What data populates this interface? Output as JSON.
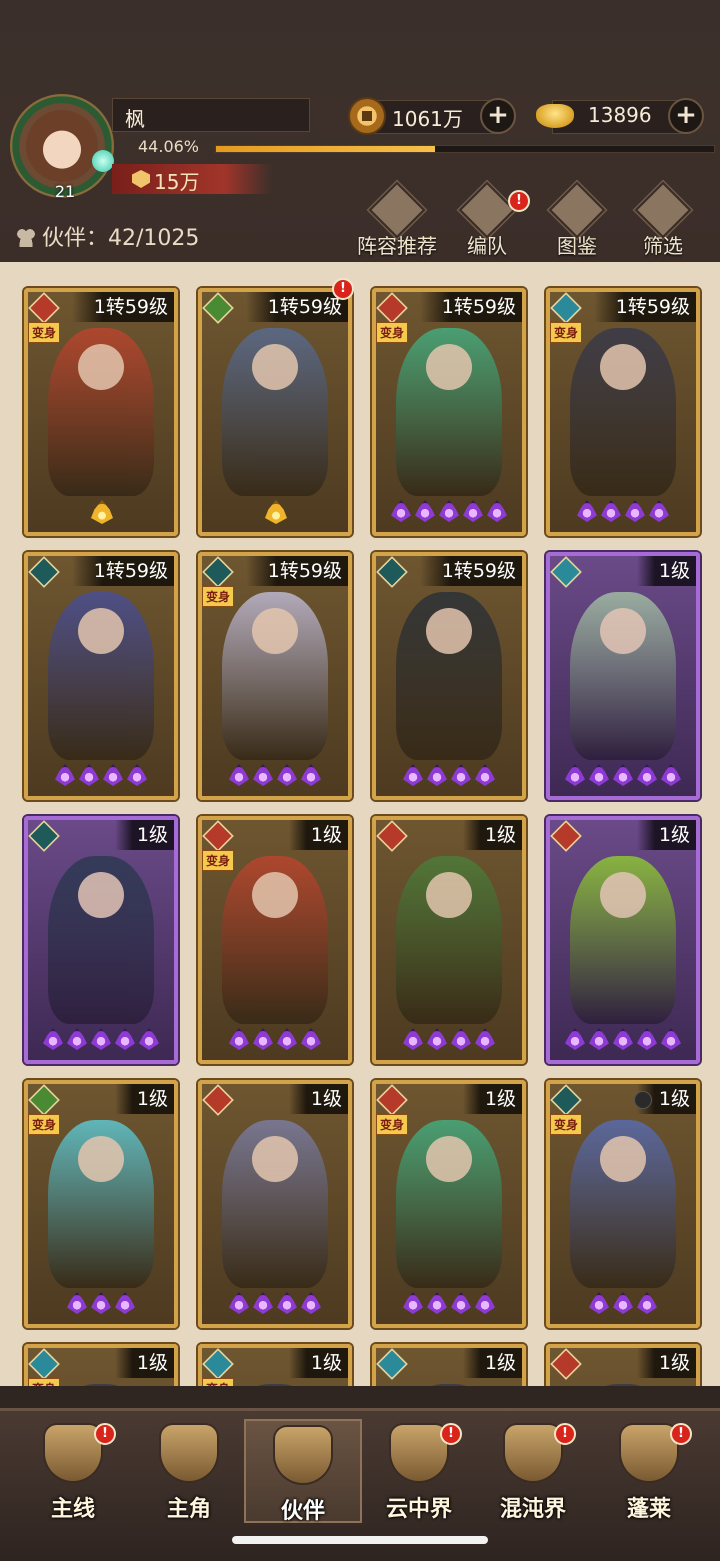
{
  "player": {
    "name": "枫",
    "level": "21",
    "exp_percent": "44.06%",
    "exp_fraction": 0.4406,
    "power": "15万"
  },
  "resources": {
    "coins": "1061万",
    "ingots": "13896",
    "plus_label": "+"
  },
  "partners": {
    "label": "伙伴：",
    "count": "42/1025"
  },
  "toolbar": [
    {
      "label": "阵容推荐",
      "icon": "lineup-recommend-icon",
      "reddot": false
    },
    {
      "label": "编队",
      "icon": "formation-flag-icon",
      "reddot": true
    },
    {
      "label": "图鉴",
      "icon": "codex-scroll-icon",
      "reddot": false
    },
    {
      "label": "筛选",
      "icon": "filter-icon",
      "reddot": false
    }
  ],
  "badge_text": "!",
  "bianshen_label": "变身",
  "cards": [
    {
      "level": "1转59级",
      "frame": "gold",
      "element": "fire",
      "bianshen": true,
      "stars": 0,
      "flame": true,
      "reddot": false,
      "art": "#b5462f"
    },
    {
      "level": "1转59级",
      "frame": "gold",
      "element": "wood",
      "bianshen": false,
      "stars": 0,
      "flame": true,
      "reddot": true,
      "art": "#5a6a8a"
    },
    {
      "level": "1转59级",
      "frame": "gold",
      "element": "fire",
      "bianshen": true,
      "stars": 5,
      "flame": false,
      "reddot": false,
      "art": "#47a77a"
    },
    {
      "level": "1转59级",
      "frame": "gold",
      "element": "water",
      "bianshen": true,
      "stars": 4,
      "flame": false,
      "reddot": false,
      "art": "#3b3b4a"
    },
    {
      "level": "1转59级",
      "frame": "gold",
      "element": "dark",
      "bianshen": false,
      "stars": 4,
      "flame": false,
      "reddot": false,
      "art": "#4b4f8f"
    },
    {
      "level": "1转59级",
      "frame": "gold",
      "element": "dark",
      "bianshen": true,
      "stars": 4,
      "flame": false,
      "reddot": false,
      "art": "#b9b3c9"
    },
    {
      "level": "1转59级",
      "frame": "gold",
      "element": "dark",
      "bianshen": false,
      "stars": 4,
      "flame": false,
      "reddot": false,
      "art": "#2f3338"
    },
    {
      "level": "1级",
      "frame": "purple",
      "element": "water",
      "bianshen": false,
      "stars": 5,
      "flame": false,
      "reddot": false,
      "art": "#9fb7a2"
    },
    {
      "level": "1级",
      "frame": "purple",
      "element": "dark",
      "bianshen": false,
      "stars": 5,
      "flame": false,
      "reddot": false,
      "art": "#2f3a55"
    },
    {
      "level": "1级",
      "frame": "gold",
      "element": "fire",
      "bianshen": true,
      "stars": 4,
      "flame": false,
      "reddot": false,
      "art": "#b5462f"
    },
    {
      "level": "1级",
      "frame": "gold",
      "element": "fire",
      "bianshen": false,
      "stars": 4,
      "flame": false,
      "reddot": false,
      "art": "#4f7a3a"
    },
    {
      "level": "1级",
      "frame": "purple",
      "element": "fire",
      "bianshen": false,
      "stars": 5,
      "flame": false,
      "reddot": false,
      "art": "#8cbf3a"
    },
    {
      "level": "1级",
      "frame": "gold",
      "element": "wood",
      "bianshen": true,
      "stars": 3,
      "flame": false,
      "reddot": false,
      "art": "#5fc0c8"
    },
    {
      "level": "1级",
      "frame": "gold",
      "element": "fire",
      "bianshen": false,
      "stars": 4,
      "flame": false,
      "reddot": false,
      "art": "#7a7a9a"
    },
    {
      "level": "1级",
      "frame": "gold",
      "element": "fire",
      "bianshen": true,
      "stars": 4,
      "flame": false,
      "reddot": false,
      "art": "#47a77a"
    },
    {
      "level": "1级",
      "frame": "gold",
      "element": "dark",
      "bianshen": true,
      "stars": 3,
      "flame": false,
      "reddot": false,
      "art": "#5a6aa8",
      "dim_orb": true
    },
    {
      "level": "1级",
      "frame": "gold",
      "element": "water",
      "bianshen": true,
      "stars": 0,
      "flame": false,
      "reddot": false,
      "art": "#3a3a4a"
    },
    {
      "level": "1级",
      "frame": "gold",
      "element": "water",
      "bianshen": true,
      "stars": 0,
      "flame": false,
      "reddot": false,
      "art": "#3a3a4a"
    },
    {
      "level": "1级",
      "frame": "gold",
      "element": "water",
      "bianshen": false,
      "stars": 0,
      "flame": false,
      "reddot": false,
      "art": "#3a3a4a"
    },
    {
      "level": "1级",
      "frame": "gold",
      "element": "fire",
      "bianshen": false,
      "stars": 0,
      "flame": false,
      "reddot": false,
      "art": "#3a3a4a"
    }
  ],
  "nav": [
    {
      "label": "主线",
      "icon": "main-quest-swords-icon",
      "reddot": true,
      "active": false
    },
    {
      "label": "主角",
      "icon": "hero-portrait-icon",
      "reddot": false,
      "active": false
    },
    {
      "label": "伙伴",
      "icon": "partner-helmet-icon",
      "reddot": false,
      "active": true
    },
    {
      "label": "云中界",
      "icon": "cloud-palace-icon",
      "reddot": true,
      "active": false
    },
    {
      "label": "混沌界",
      "icon": "chaos-realm-icon",
      "reddot": true,
      "active": false
    },
    {
      "label": "蓬莱",
      "icon": "penglai-sage-icon",
      "reddot": true,
      "active": false
    }
  ],
  "colors": {
    "header_bg": "#3b2e29",
    "grid_bg": "#e6d8c0",
    "gold_frame": "#d3a34a",
    "purple_frame": "#a66bd4",
    "exp_bar": "#f0a82a",
    "reddot": "#d9241b"
  }
}
